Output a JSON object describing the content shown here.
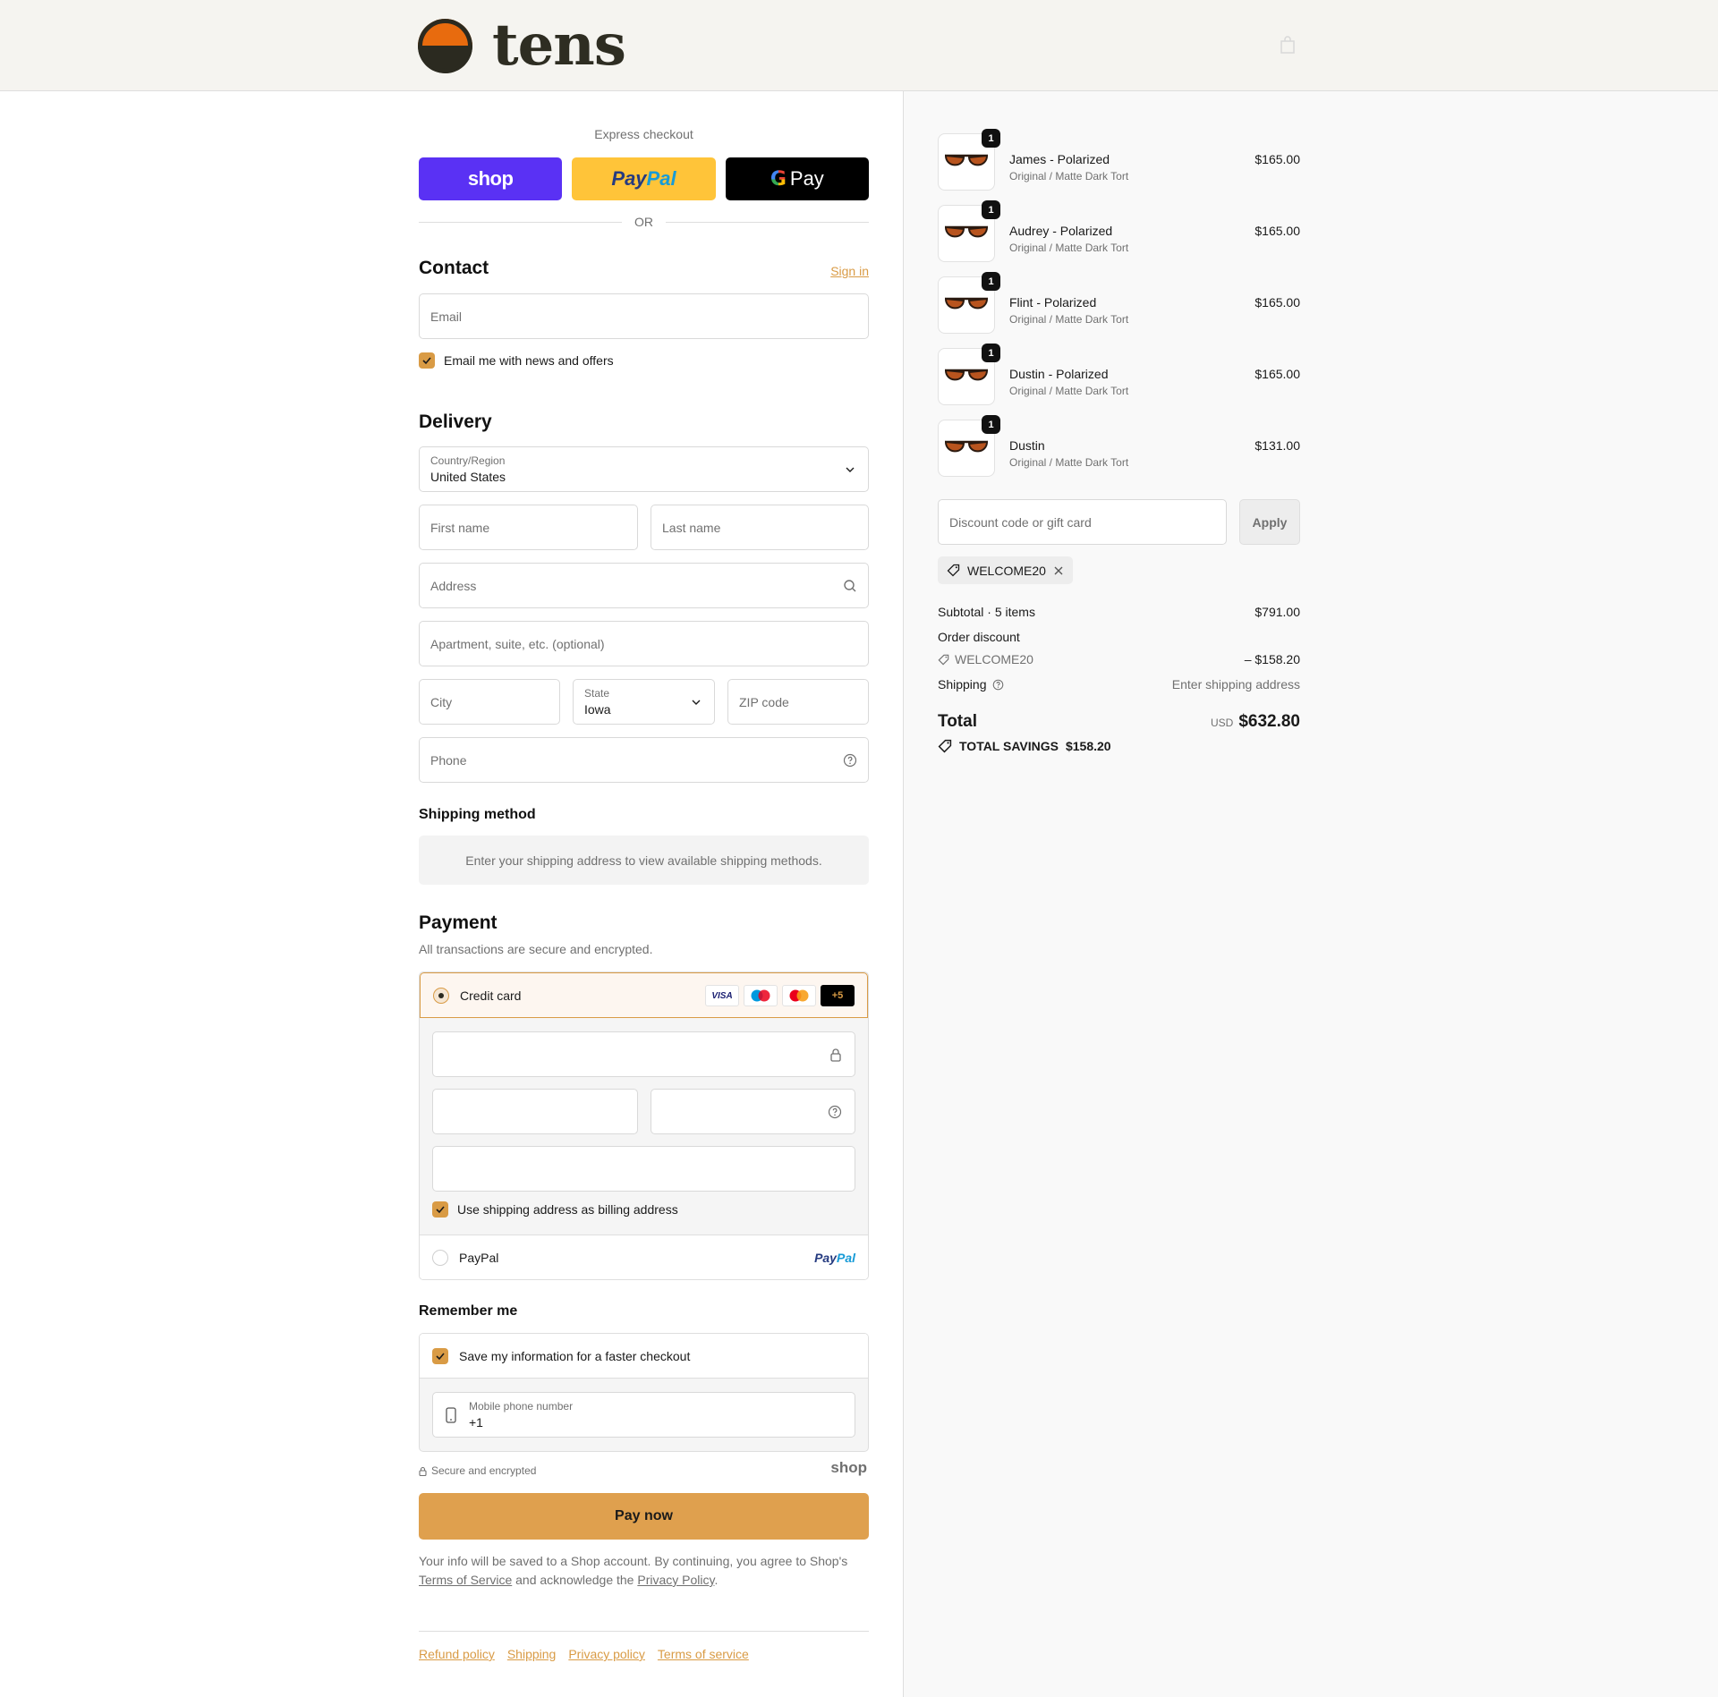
{
  "brand": {
    "name": "tens"
  },
  "express": {
    "title": "Express checkout",
    "shop_label": "shop",
    "paypal_a": "Pay",
    "paypal_b": "Pal",
    "gpay_g": "G",
    "gpay_label": "Pay",
    "or": "OR"
  },
  "contact": {
    "title": "Contact",
    "sign_in": "Sign in",
    "email_placeholder": "Email",
    "news_label": "Email me with news and offers"
  },
  "delivery": {
    "title": "Delivery",
    "country_label": "Country/Region",
    "country_value": "United States",
    "first_name": "First name",
    "last_name": "Last name",
    "address": "Address",
    "apartment": "Apartment, suite, etc. (optional)",
    "city": "City",
    "state_label": "State",
    "state_value": "Iowa",
    "zip": "ZIP code",
    "phone": "Phone"
  },
  "shipping_method": {
    "title": "Shipping method",
    "info": "Enter your shipping address to view available shipping methods."
  },
  "payment": {
    "title": "Payment",
    "subtitle": "All transactions are secure and encrypted.",
    "credit_card": "Credit card",
    "cards": [
      "VISA",
      "",
      "",
      "+5"
    ],
    "billing_label": "Use shipping address as billing address",
    "paypal": "PayPal",
    "paypal_logo_a": "Pay",
    "paypal_logo_b": "Pal"
  },
  "remember": {
    "title": "Remember me",
    "save_label": "Save my information for a faster checkout",
    "mobile_label": "Mobile phone number",
    "mobile_value": "+1",
    "secure": "Secure and encrypted",
    "shop": "shop"
  },
  "pay_now": "Pay now",
  "legal": {
    "text1": "Your info will be saved to a Shop account. By continuing, you agree to Shop's",
    "tos": "Terms of Service",
    "text2": "and acknowledge the",
    "privacy": "Privacy Policy",
    "text3": "."
  },
  "footer": {
    "links": [
      "Refund policy",
      "Shipping",
      "Privacy policy",
      "Terms of service"
    ]
  },
  "cart": {
    "items": [
      {
        "name": "James - Polarized",
        "variant": "Original / Matte Dark Tort",
        "price": "$165.00",
        "qty": "1"
      },
      {
        "name": "Audrey - Polarized",
        "variant": "Original / Matte Dark Tort",
        "price": "$165.00",
        "qty": "1"
      },
      {
        "name": "Flint - Polarized",
        "variant": "Original / Matte Dark Tort",
        "price": "$165.00",
        "qty": "1"
      },
      {
        "name": "Dustin - Polarized",
        "variant": "Original / Matte Dark Tort",
        "price": "$165.00",
        "qty": "1"
      },
      {
        "name": "Dustin",
        "variant": "Original / Matte Dark Tort",
        "price": "$131.00",
        "qty": "1"
      }
    ],
    "discount_placeholder": "Discount code or gift card",
    "apply": "Apply",
    "applied_code": "WELCOME20",
    "subtotal_label": "Subtotal · 5 items",
    "subtotal": "$791.00",
    "order_discount_label": "Order discount",
    "discount_code": "WELCOME20",
    "discount_amount": "– $158.20",
    "shipping_label": "Shipping",
    "shipping_value": "Enter shipping address",
    "total_label": "Total",
    "currency": "USD",
    "total": "$632.80",
    "savings_label": "TOTAL SAVINGS",
    "savings": "$158.20"
  },
  "colors": {
    "accent": "#dfa04e",
    "shop_purple": "#5a31f4",
    "paypal_yellow": "#ffc439",
    "logo_orange": "#e86b0e"
  }
}
